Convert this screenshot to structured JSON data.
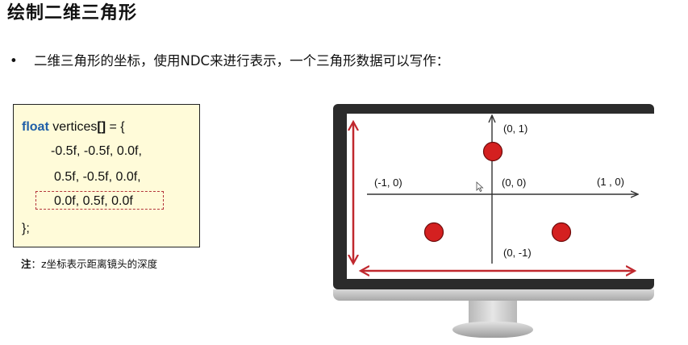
{
  "page": {
    "title": "绘制二维三角形",
    "bullet_text": "二维三角形的坐标，使用NDC来进行表示，一个三角形数据可以写作："
  },
  "code": {
    "keyword": "float",
    "decl_name": "vertices",
    "decl_brackets": "[]",
    "decl_rest": " = {",
    "lines": [
      "-0.5f, -0.5f, 0.0f,",
      "0.5f, -0.5f, 0.0f,",
      "0.0f,  0.5f, 0.0f"
    ],
    "closing": "};"
  },
  "note": {
    "label": "注",
    "text": "：z坐标表示距离镜头的深度"
  },
  "diagram": {
    "labels": {
      "top": "(0,   1)",
      "left": "(-1,   0)",
      "center": "(0,   0)",
      "right": "(1  ,   0)",
      "bottom": "(0,   -1)"
    },
    "colors": {
      "point_fill": "#d42020",
      "arrow": "#c0282e",
      "axis": "#333333"
    }
  }
}
